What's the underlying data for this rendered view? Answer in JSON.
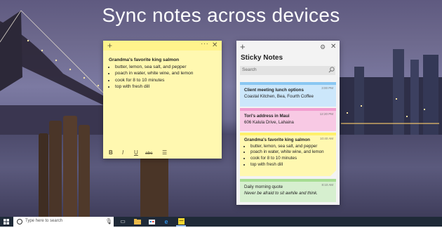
{
  "headline": "Sync notes across devices",
  "colors": {
    "note_yellow": "#fff8b0",
    "note_yellow_bar": "#fff38c",
    "card_blue": "#cce7fb",
    "card_blue_strip": "#8ac7f2",
    "card_pink": "#f8c9e4",
    "card_pink_strip": "#f29dcf",
    "card_yellow": "#fff8b0",
    "card_yellow_strip": "#fff06a",
    "card_green": "#d6efcf",
    "card_green_strip": "#a6dc92",
    "taskbar": "#1f2a38"
  },
  "editor_note": {
    "title": "Grandma's favorite king salmon",
    "items": [
      "butter, lemon, sea salt, and pepper",
      "poach in water, white wine, and lemon",
      "cook for 8 to 10 minutes",
      "top with fresh dill"
    ],
    "toolbar": {
      "bold": "B",
      "italic": "I",
      "underline": "U",
      "strikethrough": "abc",
      "bullets": "☰"
    },
    "icons": [
      "plus-icon",
      "more-icon",
      "close-icon"
    ]
  },
  "panel": {
    "title": "Sticky Notes",
    "search_placeholder": "Search",
    "cards": [
      {
        "time": "3:00 PM",
        "title": "Client meeting lunch options",
        "line": "Coastal Kitchen, Bea, Fourth Coffee"
      },
      {
        "time": "12:20 PM",
        "title": "Tori's address in Maui",
        "line": "606 Kalula Drive, Lahaina"
      },
      {
        "time": "10:40 AM",
        "title": "Grandma's favorite king salmon",
        "items": [
          "butter, lemon, sea salt, and pepper",
          "poach in water, white wine, and lemon",
          "cook for 8 to 10 minutes",
          "top with fresh dill"
        ]
      },
      {
        "time": "8:10 AM",
        "title": "Daily morning quote",
        "line": "Never be afraid to sit awhile and think."
      }
    ]
  },
  "taskbar": {
    "search_placeholder": "Type here to search"
  }
}
